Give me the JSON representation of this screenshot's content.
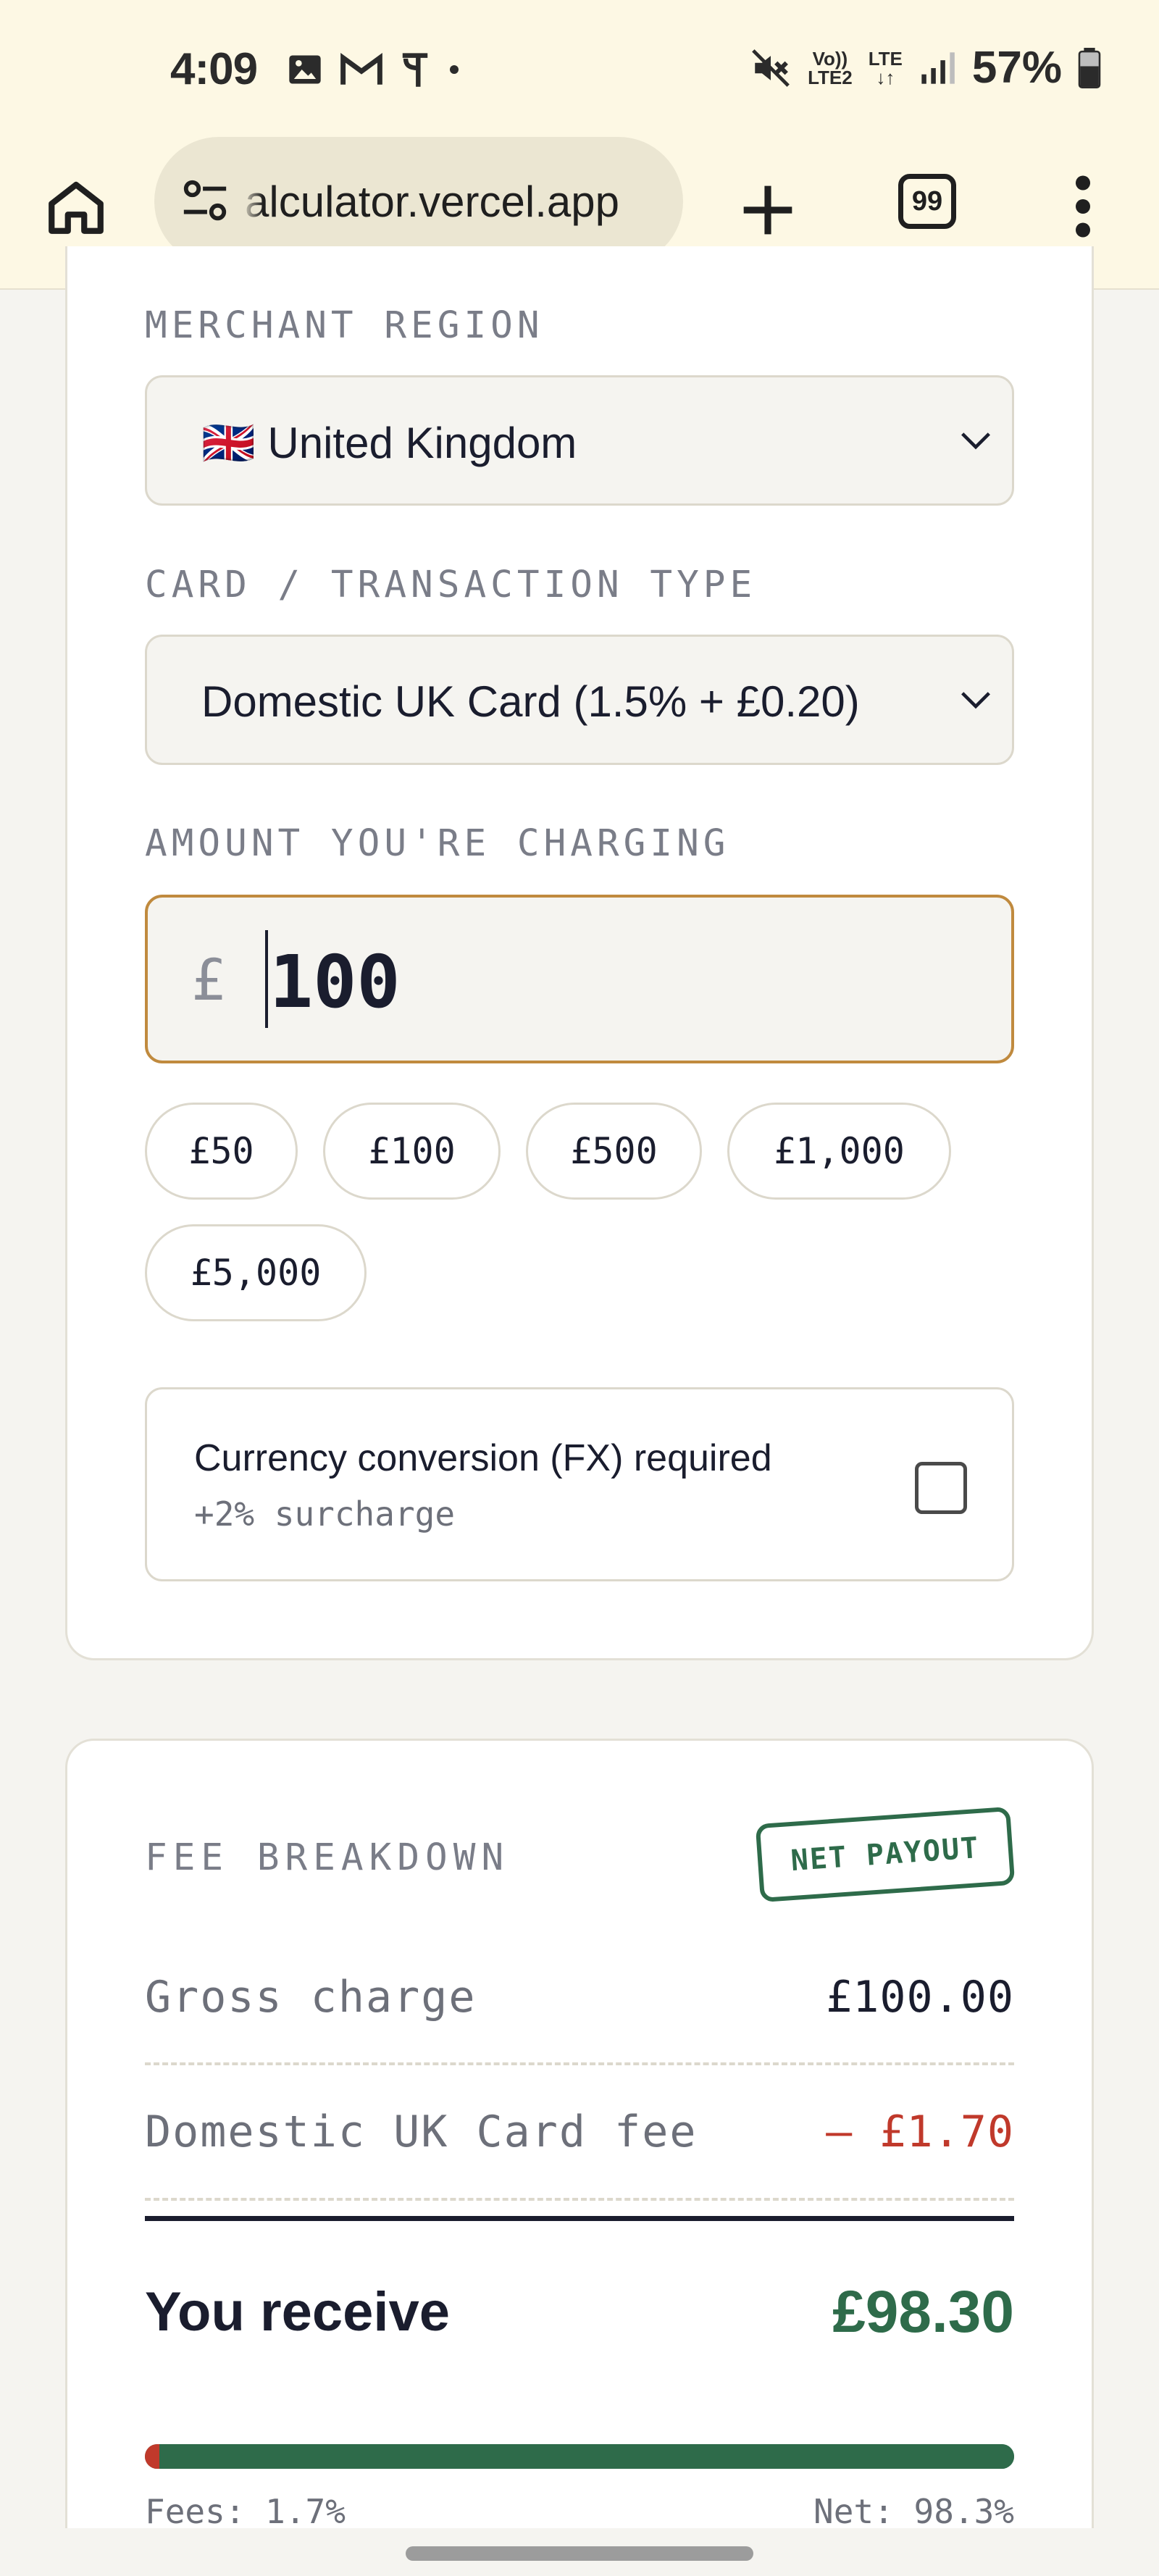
{
  "status_bar": {
    "time": "4:09",
    "network_top": "Vo))",
    "network_bottom": "LTE2",
    "lte_label": "LTE",
    "battery": "57%"
  },
  "browser": {
    "url": "alculator.vercel.app",
    "tab_count": "99"
  },
  "form": {
    "region_label": "MERCHANT REGION",
    "region_value": "🇬🇧 United Kingdom",
    "card_type_label": "CARD / TRANSACTION TYPE",
    "card_type_value": "Domestic UK Card (1.5% + £0.20)",
    "amount_label": "AMOUNT YOU'RE CHARGING",
    "currency_symbol": "£",
    "amount_value": "100",
    "presets": [
      "£50",
      "£100",
      "£500",
      "£1,000",
      "£5,000"
    ],
    "fx": {
      "title": "Currency conversion (FX) required",
      "subtitle": "+2% surcharge",
      "checked": false
    }
  },
  "breakdown": {
    "heading": "FEE BREAKDOWN",
    "stamp": "NET PAYOUT",
    "gross_label": "Gross charge",
    "gross_value": "£100.00",
    "fee_label": "Domestic UK Card fee",
    "fee_value": "– £1.70",
    "receive_label": "You receive",
    "receive_value": "£98.30",
    "fees_caption": "Fees: 1.7%",
    "net_caption": "Net: 98.3%",
    "fee_fraction": 0.017,
    "colors": {
      "fee": "#c0392b",
      "net": "#2e6b4a",
      "accent": "#c08a3e"
    }
  }
}
